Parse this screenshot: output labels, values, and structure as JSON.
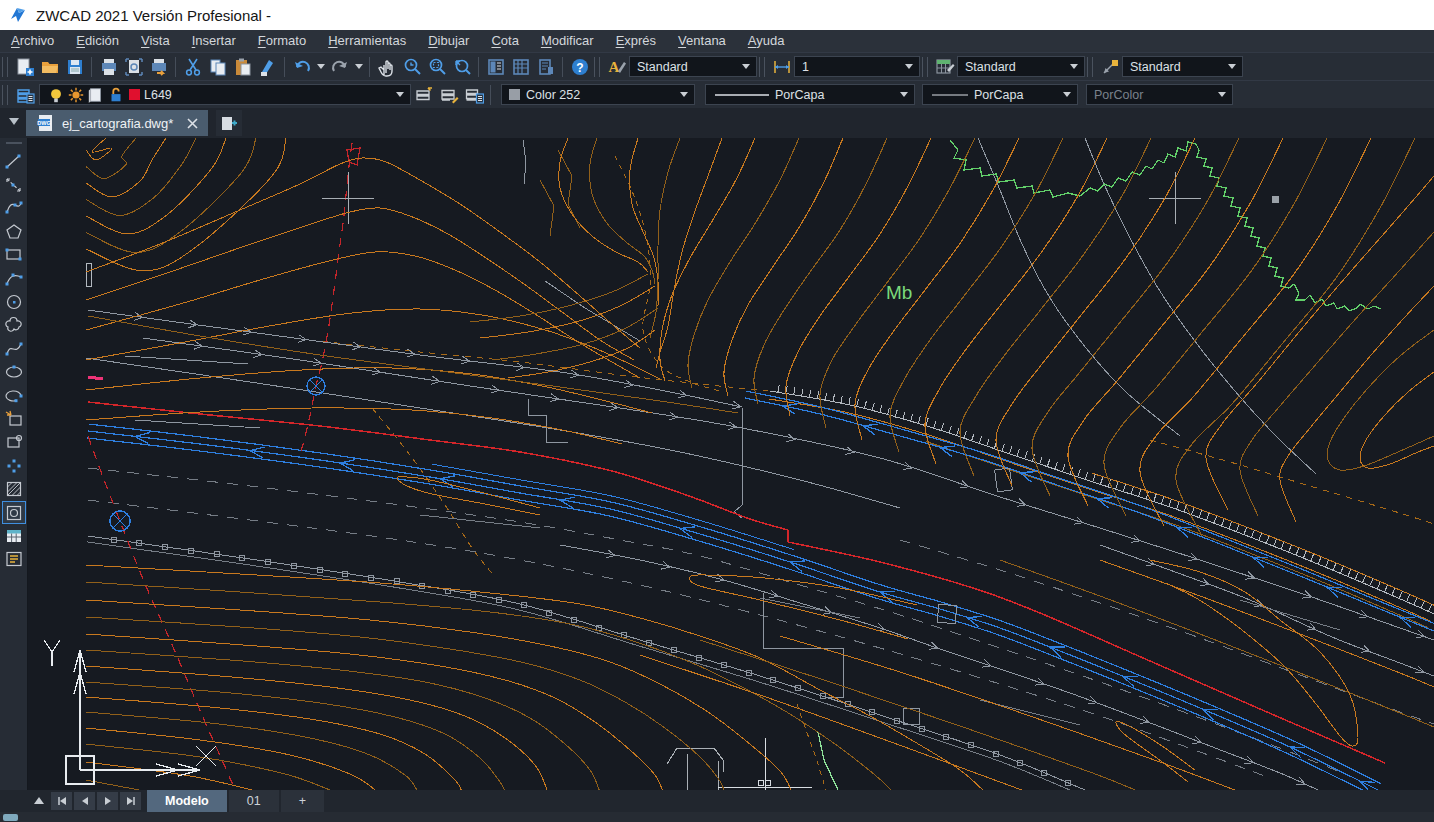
{
  "window": {
    "title": "ZWCAD 2021 Versión Profesional -"
  },
  "menu": [
    "Archivo",
    "Edición",
    "Vista",
    "Insertar",
    "Formato",
    "Herramientas",
    "Dibujar",
    "Cota",
    "Modificar",
    "Exprés",
    "Ventana",
    "Ayuda"
  ],
  "toolbar_row1": {
    "groups": [
      [
        "new-file",
        "open-folder",
        "save"
      ],
      [
        "print",
        "print-preview",
        "plot-export"
      ],
      [
        "cut",
        "copy",
        "paste",
        "format-painter"
      ],
      [
        "undo",
        "redo"
      ],
      [
        "pan",
        "zoom-realtime",
        "zoom-window",
        "zoom-previous"
      ],
      [
        "properties-palette",
        "sheet-palette",
        "quickcalc-palette"
      ],
      [
        "help"
      ]
    ],
    "combos": [
      {
        "icon": "text-style",
        "value": "Standard",
        "w": 128
      },
      {
        "icon": "dim-style",
        "value": "1",
        "w": 126
      },
      {
        "icon": "table-style",
        "value": "Standard",
        "w": 128
      },
      {
        "icon": "mleader-style",
        "value": "Standard",
        "w": 121
      }
    ]
  },
  "toolbar_row2": {
    "layer_combo": {
      "state_icons": [
        "bulb-on",
        "sun-freeze",
        "page-plot",
        "lock-open"
      ],
      "swatch_color": "#e0102e",
      "value": "L649"
    },
    "layer_tools": [
      "layer-previous",
      "layer-states",
      "layer-properties"
    ],
    "color_combo": {
      "swatch_color": "#989ea6",
      "value": "Color 252"
    },
    "linetype_combo": {
      "value": "PorCapa"
    },
    "lineweight_combo": {
      "value": "PorCapa"
    },
    "plotstyle_combo": {
      "value": "PorColor"
    }
  },
  "doc_tabs": {
    "active": "ej_cartografia.dwg*"
  },
  "draw_tools": [
    "line",
    "construction-line",
    "polyline",
    "polygon",
    "rectangle",
    "arc",
    "circle",
    "revision-cloud",
    "spline",
    "ellipse",
    "ellipse-arc",
    "insert-block",
    "create-block",
    "point",
    "hatch",
    "region",
    "table",
    "mtext"
  ],
  "canvas": {
    "annotation": "Mb"
  },
  "model_tabs": {
    "model": "Modelo",
    "layout1": "01",
    "add_tab": "+"
  }
}
